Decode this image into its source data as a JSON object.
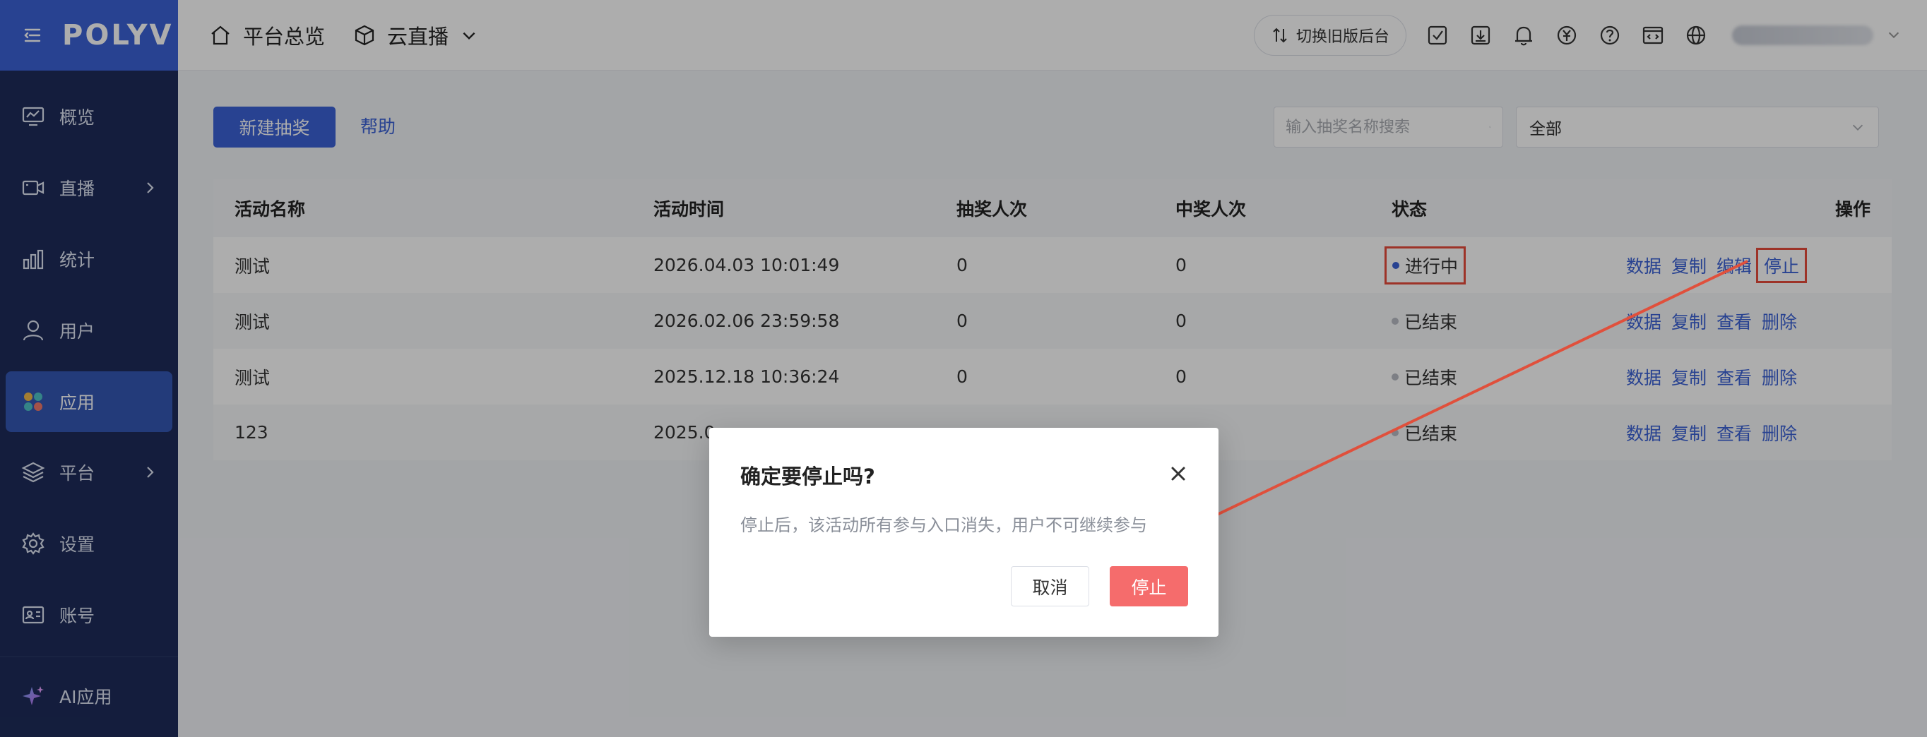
{
  "app": {
    "logo": "POLYV"
  },
  "sidebar": {
    "items": [
      {
        "label": "概览",
        "icon": "chart-monitor-icon"
      },
      {
        "label": "直播",
        "icon": "video-camera-icon"
      },
      {
        "label": "统计",
        "icon": "bar-chart-icon"
      },
      {
        "label": "用户",
        "icon": "user-icon"
      },
      {
        "label": "应用",
        "icon": "apps-grid-icon"
      },
      {
        "label": "平台",
        "icon": "layers-icon"
      },
      {
        "label": "设置",
        "icon": "gear-icon"
      },
      {
        "label": "账号",
        "icon": "id-card-icon"
      },
      {
        "label": "AI应用",
        "icon": "ai-sparkle-icon"
      }
    ],
    "active_label": "应用"
  },
  "header": {
    "home_label": "平台总览",
    "live_label": "云直播",
    "switch_label": "切换旧版后台"
  },
  "toolbar": {
    "new_label": "新建抽奖",
    "help_label": "帮助",
    "search_placeholder": "输入抽奖名称搜索",
    "filter_value": "全部"
  },
  "table": {
    "headers": {
      "name": "活动名称",
      "time": "活动时间",
      "draws": "抽奖人次",
      "wins": "中奖人次",
      "status": "状态",
      "ops": "操作"
    },
    "rows": [
      {
        "name": "测试",
        "time": "2026.04.03 10:01:49",
        "draws": "0",
        "wins": "0",
        "status": "进行中",
        "status_color": "#3b62d6",
        "ops": [
          "数据",
          "复制",
          "编辑",
          "停止"
        ]
      },
      {
        "name": "测试",
        "time": "2026.02.06 23:59:58",
        "draws": "0",
        "wins": "0",
        "status": "已结束",
        "status_color": "#b8bcc4",
        "ops": [
          "数据",
          "复制",
          "查看",
          "删除"
        ]
      },
      {
        "name": "测试",
        "time": "2025.12.18 10:36:24",
        "draws": "0",
        "wins": "0",
        "status": "已结束",
        "status_color": "#b8bcc4",
        "ops": [
          "数据",
          "复制",
          "查看",
          "删除"
        ]
      },
      {
        "name": "123",
        "time": "2025.0",
        "draws": "",
        "wins": "",
        "status": "已结束",
        "status_color": "#b8bcc4",
        "ops": [
          "数据",
          "复制",
          "查看",
          "删除"
        ]
      }
    ]
  },
  "dialog": {
    "title": "确定要停止吗?",
    "message": "停止后，该活动所有参与入口消失，用户不可继续参与",
    "cancel_label": "取消",
    "confirm_label": "停止"
  },
  "colors": {
    "sidebar_bg": "#1e2c5a",
    "brand_blue": "#3b62d6",
    "danger": "#f56c6c",
    "annotation_red": "#e74c3c"
  }
}
